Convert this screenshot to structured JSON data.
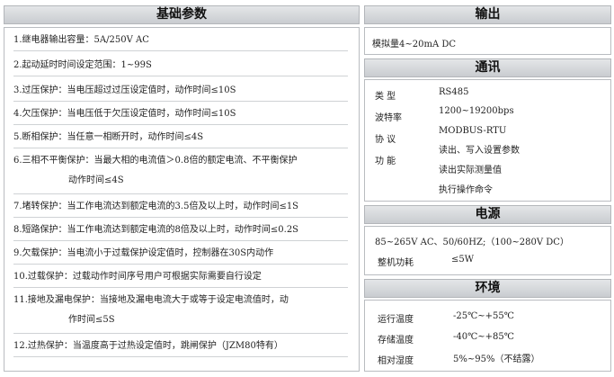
{
  "basic": {
    "title": "基础参数",
    "items": [
      {
        "l1": "1.继电器输出容量：5A/250V AC",
        "l2": ""
      },
      {
        "l1": "2.起动延时时间设定范围：1~99S",
        "l2": ""
      },
      {
        "l1": "3.过压保护：当电压超过过压设定值时，动作时间≤10S",
        "l2": ""
      },
      {
        "l1": "4.欠压保护：当电压低于欠压设定值时，动作时间≤10S",
        "l2": ""
      },
      {
        "l1": "5.断相保护：当任意一相断开时，动作时间≤4S",
        "l2": ""
      },
      {
        "l1": "6.三相不平衡保护：当最大相的电流值＞0.8倍的额定电流、不平衡保护",
        "l2": "动作时间≤4S"
      },
      {
        "l1": "7.堵转保护：当工作电流达到额定电流的3.5倍及以上时，动作时间≤1S",
        "l2": ""
      },
      {
        "l1": "8.短路保护：当工作电流达到额定电流的8倍及以上时，动作时间≤0.2S",
        "l2": ""
      },
      {
        "l1": "9.欠载保护：当电流小于过载保护设定值时，控制器在30S内动作",
        "l2": ""
      },
      {
        "l1": "10.过载保护：过载动作时间序号用户可根据实际需要自行设定",
        "l2": ""
      },
      {
        "l1": "11.接地及漏电保护：当接地及漏电电流大于或等于设定电流值时，动",
        "l2": "作时间≤5S"
      },
      {
        "l1": "12.过热保护：当温度高于过热设定值时，跳闸保护（JZM80特有）",
        "l2": ""
      }
    ]
  },
  "output": {
    "title": "输出",
    "text": "模拟量4~20mA  DC"
  },
  "comm": {
    "title": "通讯",
    "type_label": "类    型",
    "type_value": "RS485",
    "baud_label": "波特率",
    "baud_value": "1200~19200bps",
    "proto_label": "协    议",
    "proto_value": "MODBUS-RTU",
    "func_label": "功    能",
    "func_values": [
      "读出、写入设置参数",
      "读出实际测量值",
      "执行操作命令"
    ]
  },
  "power": {
    "title": "电源",
    "range": "85~265V AC、50/60HZ;（100~280V DC）",
    "consumption_label": "整机功耗",
    "consumption_value": "≤5W"
  },
  "env": {
    "title": "环境",
    "rows": [
      {
        "label": "运行温度",
        "value": "-25℃~+55℃"
      },
      {
        "label": "存储温度",
        "value": "-40℃~+85℃"
      },
      {
        "label": "相对湿度",
        "value": "5%~95%（不结露）"
      }
    ]
  }
}
